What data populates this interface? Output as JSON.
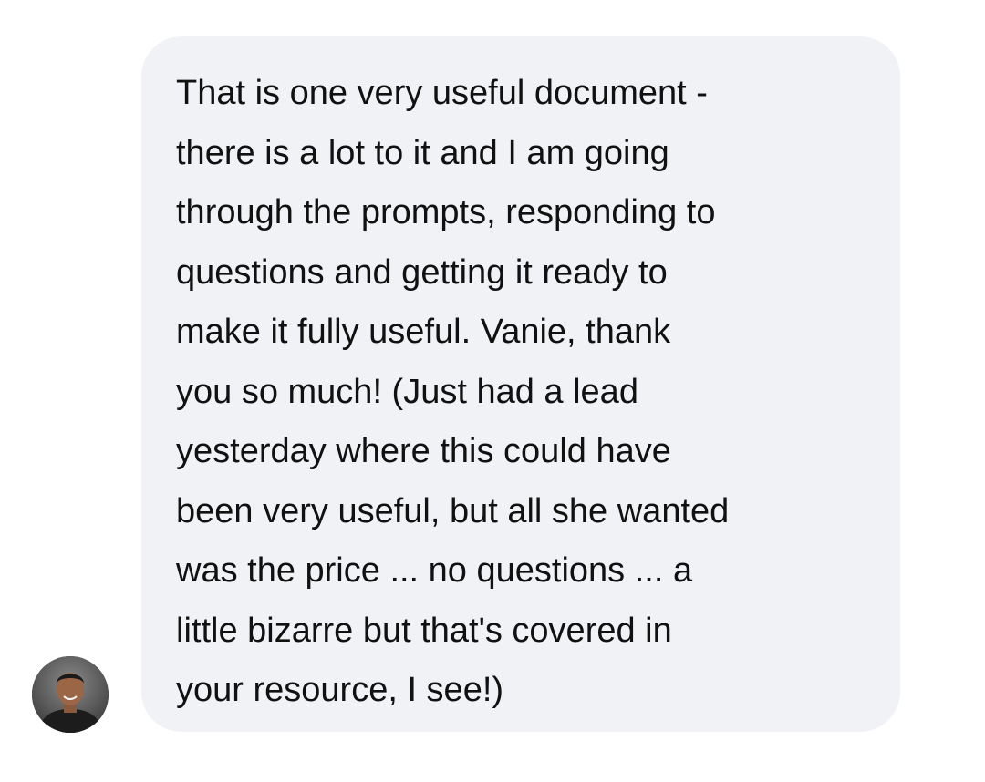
{
  "message": {
    "lines": [
      "That is one very useful document -",
      "there is a lot to it and I am going",
      "through the prompts, responding to",
      "questions and getting it ready to",
      "make it fully useful. Vanie, thank",
      "you so much! (Just had a lead",
      "yesterday where this could have",
      "been very useful, but all she wanted",
      "was the price ... no questions ... a",
      "little bizarre but that's covered in",
      "your resource, I see!)"
    ],
    "bubble_color": "#f1f2f6",
    "text_color": "#111111"
  },
  "sender": {
    "avatar_icon": "person-photo-avatar"
  }
}
